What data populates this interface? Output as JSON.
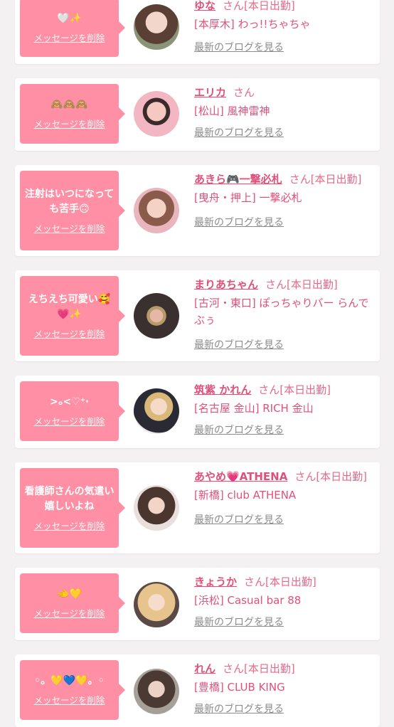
{
  "delete_label": "メッセージを削除",
  "blog_label": "最新のブログを見る",
  "cards": [
    {
      "message": "🤍✨",
      "name": "ゆな",
      "suffix": "さん[本日出勤]",
      "shop": "[本厚木] わっ!!ちゃちゃ"
    },
    {
      "message": "🙈🙈🙈",
      "name": "エリカ",
      "suffix": "さん",
      "shop": "[松山] 風神雷神"
    },
    {
      "message": "注射はいつになっても苦手🙃",
      "name": "あきら🎮一撃必札",
      "suffix": "さん[本日出勤]",
      "shop": "[曳舟・押上] 一撃必札"
    },
    {
      "message": "えちえち可愛い🥰💗✨",
      "name": "まりあちゃん",
      "suffix": "さん[本日出勤]",
      "shop": "[古河・東口] ぽっちゃりバー らんでぶぅ"
    },
    {
      "message": ">ₒ<♡⁺‧",
      "name": "筑紫 かれん",
      "suffix": "さん[本日出勤]",
      "shop": "[名古屋 金山] RICH 金山"
    },
    {
      "message": "看護師さんの気遣い嬉しいよね",
      "name": "あやめ💗ATHENA",
      "suffix": "さん[本日出勤]",
      "shop": "[新橋] club ATHENA"
    },
    {
      "message": "🫲💛",
      "name": "きょうか",
      "suffix": "さん[本日出勤]",
      "shop": "[浜松] Casual bar 88"
    },
    {
      "message": "◦。💛💙💛。◦",
      "name": "れん",
      "suffix": "さん[本日出勤]",
      "shop": "[豊橋] CLUB KING"
    }
  ]
}
